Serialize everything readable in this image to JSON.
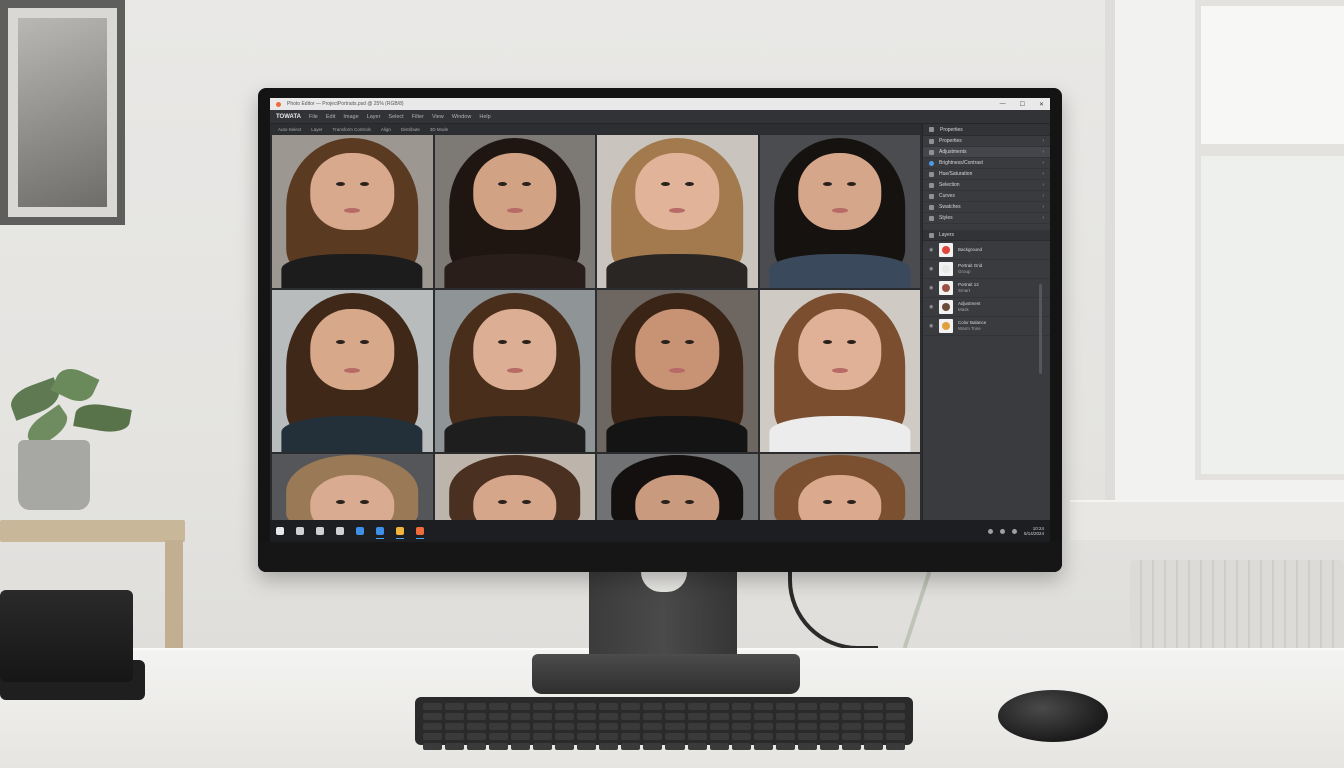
{
  "window": {
    "title": "Photo Editor — ProjectPortraits.psd @ 25% (RGB/8)",
    "controls": [
      "—",
      "☐",
      "✕"
    ]
  },
  "toolbar": {
    "brand": "TOWATA",
    "tools": [
      "File",
      "Edit",
      "Image",
      "Layer",
      "Select",
      "Filter",
      "View",
      "Window",
      "Help"
    ]
  },
  "optionsbar": {
    "items": [
      "Auto-Select",
      "Layer",
      "Transform Controls",
      "Align",
      "Distribute",
      "3D Mode"
    ]
  },
  "panel": {
    "header": "Properties",
    "rows": [
      {
        "label": "Properties",
        "active": false
      },
      {
        "label": "Adjustments",
        "active": true
      },
      {
        "label": "Brightness/Contrast",
        "active": false,
        "blue": true
      },
      {
        "label": "Hue/Saturation",
        "active": false
      },
      {
        "label": "Selection",
        "active": false
      },
      {
        "label": "Curves",
        "active": false
      },
      {
        "label": "Swatches",
        "active": false
      },
      {
        "label": "Styles",
        "active": false
      }
    ],
    "layers_header": "Layers",
    "layers": [
      {
        "name": "Background",
        "sub": "",
        "color": "#e0463a"
      },
      {
        "name": "Portrait Grid",
        "sub": "Group",
        "color": "#e8e8e8"
      },
      {
        "name": "Portrait 12",
        "sub": "Smart",
        "color": "#9c5040"
      },
      {
        "name": "Adjustment",
        "sub": "Mask",
        "color": "#6b4a3a"
      },
      {
        "name": "Color Balance",
        "sub": "Warm Tone",
        "color": "#e0a040"
      }
    ]
  },
  "grid": {
    "tiles": [
      {
        "bg": "#9d9792",
        "hair": "#5b3a22",
        "skin": "#d9a98e",
        "top": "#1c1c1c"
      },
      {
        "bg": "#7d7974",
        "hair": "#1f1612",
        "skin": "#d2a285",
        "top": "#2a1e1a"
      },
      {
        "bg": "#c9c5be",
        "hair": "#a27a4d",
        "skin": "#e1b49a",
        "top": "#2a2624"
      },
      {
        "bg": "#4a4c4f",
        "hair": "#161210",
        "skin": "#d6a68a",
        "top": "#3a4a5c"
      },
      {
        "bg": "#b9bcbd",
        "hair": "#3f2818",
        "skin": "#d8a88b",
        "top": "#23303a"
      },
      {
        "bg": "#8f9597",
        "hair": "#4a2e1c",
        "skin": "#dcae93",
        "top": "#1e1e1e"
      },
      {
        "bg": "#6e6660",
        "hair": "#3a2416",
        "skin": "#c89274",
        "top": "#141414"
      },
      {
        "bg": "#cfcac4",
        "hair": "#7a4e2e",
        "skin": "#e0b097",
        "top": "#ececec"
      },
      {
        "bg": "#55565a",
        "hair": "#9a7a56",
        "skin": "#d9ab90",
        "top": "#222"
      },
      {
        "bg": "#bdb5ab",
        "hair": "#4a3020",
        "skin": "#d6a68b",
        "top": "#222"
      },
      {
        "bg": "#707274",
        "hair": "#141010",
        "skin": "#c99a7e",
        "top": "#222"
      },
      {
        "bg": "#8a8580",
        "hair": "#7a5030",
        "skin": "#dba98e",
        "top": "#222"
      }
    ]
  },
  "taskbar": {
    "apps": [
      {
        "name": "start-icon",
        "color": "#e8e8ea"
      },
      {
        "name": "search-icon",
        "color": "#cfd0d4"
      },
      {
        "name": "task-view-icon",
        "color": "#cfd0d4"
      },
      {
        "name": "files-icon",
        "color": "#cfd0d4"
      },
      {
        "name": "browser-icon",
        "color": "#3f8fe8"
      },
      {
        "name": "mail-icon",
        "color": "#3f8fe8",
        "active": true
      },
      {
        "name": "photos-icon",
        "color": "#f0b43c",
        "active": true
      },
      {
        "name": "editor-icon",
        "color": "#f06b3c",
        "active": true
      }
    ],
    "time": "10:24",
    "date": "5/14/2024"
  }
}
